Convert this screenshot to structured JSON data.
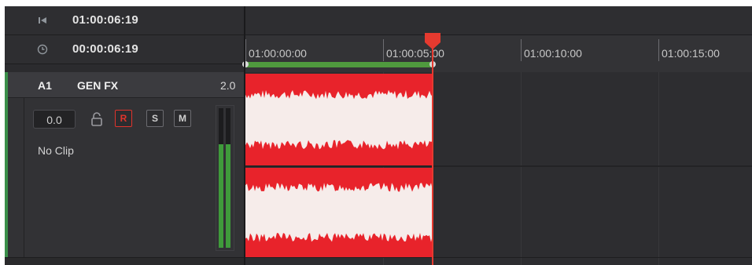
{
  "header": {
    "record_timecode": "01:00:06:19",
    "duration_timecode": "00:00:06:19"
  },
  "track": {
    "id": "A1",
    "name": "GEN FX",
    "channels": "2.0",
    "volume": "0.0",
    "buttons": {
      "record": "R",
      "solo": "S",
      "mute": "M"
    },
    "status": "No Clip",
    "meter_left_level": 0.74,
    "meter_right_level": 0.74
  },
  "ruler": {
    "labels": [
      "01:00:00:00",
      "01:00:05:00",
      "01:00:10:00",
      "01:00:15:00"
    ]
  },
  "colors": {
    "accent_red": "#e53a2f",
    "clip_red": "#e8232b",
    "waveform": "#f6ecea",
    "inout_green": "#4f9a3e",
    "track_green": "#3b8f4a"
  },
  "icons": {
    "first_frame": "skip-to-start-icon",
    "duration": "clock-icon",
    "lock": "lock-icon"
  }
}
